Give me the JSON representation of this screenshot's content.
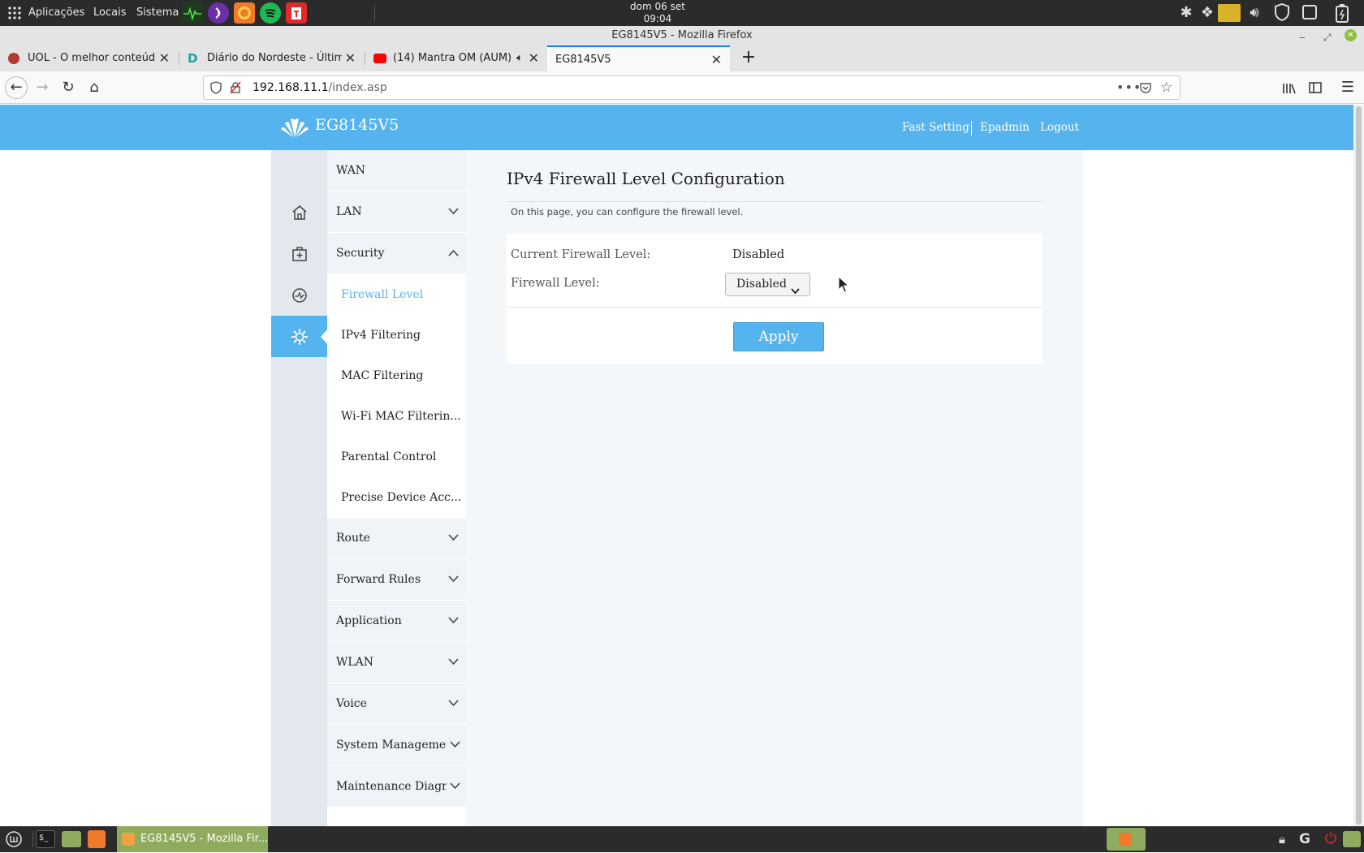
{
  "system_panel": {
    "menu": [
      "Aplicações",
      "Locais",
      "Sistema"
    ],
    "clock_line1": "dom 06 set",
    "clock_line2": "09:04"
  },
  "window": {
    "title": "EG8145V5 - Mozilla Firefox"
  },
  "tabs": [
    {
      "label": "UOL - O melhor conteúdo",
      "icon": "uol-icon",
      "icon_color": "#b23a2e"
    },
    {
      "label": "Diário do Nordeste - Última",
      "icon": "diario-icon",
      "icon_color": "#1aa3a3"
    },
    {
      "label": "(14) Mantra OM (AUM) -",
      "icon": "youtube-icon",
      "icon_color": "#ff0000"
    },
    {
      "label": "EG8145V5",
      "icon": "",
      "icon_color": ""
    }
  ],
  "urlbar": {
    "host": "192.168.11.1",
    "path": "/index.asp"
  },
  "header": {
    "brand": "EG8145V5",
    "links": [
      "Fast Setting",
      "Epadmin",
      "Logout"
    ],
    "accent_color": "#55b4ee"
  },
  "sidebar": {
    "icons": [
      "home-icon",
      "first-aid-icon",
      "diagnose-icon",
      "gear-icon"
    ],
    "active_icon": "gear-icon",
    "menu_top": [
      "WAN",
      "LAN",
      "Security"
    ],
    "security_items": [
      "Firewall Level",
      "IPv4 Filtering",
      "MAC Filtering",
      "Wi-Fi MAC Filterin...",
      "Parental Control",
      "Precise Device Acc..."
    ],
    "active_item": "Firewall Level",
    "menu_bottom": [
      "Route",
      "Forward Rules",
      "Application",
      "WLAN",
      "Voice",
      "System Managemen",
      "Maintenance Diagno"
    ]
  },
  "main": {
    "title": "IPv4 Firewall Level Configuration",
    "description": "On this page, you can configure the firewall level.",
    "current_label": "Current Firewall Level:",
    "current_value": "Disabled",
    "level_label": "Firewall Level:",
    "level_selected": "Disabled",
    "apply_label": "Apply"
  },
  "taskbar": {
    "active_window": "EG8145V5 - Mozilla Fir..."
  }
}
